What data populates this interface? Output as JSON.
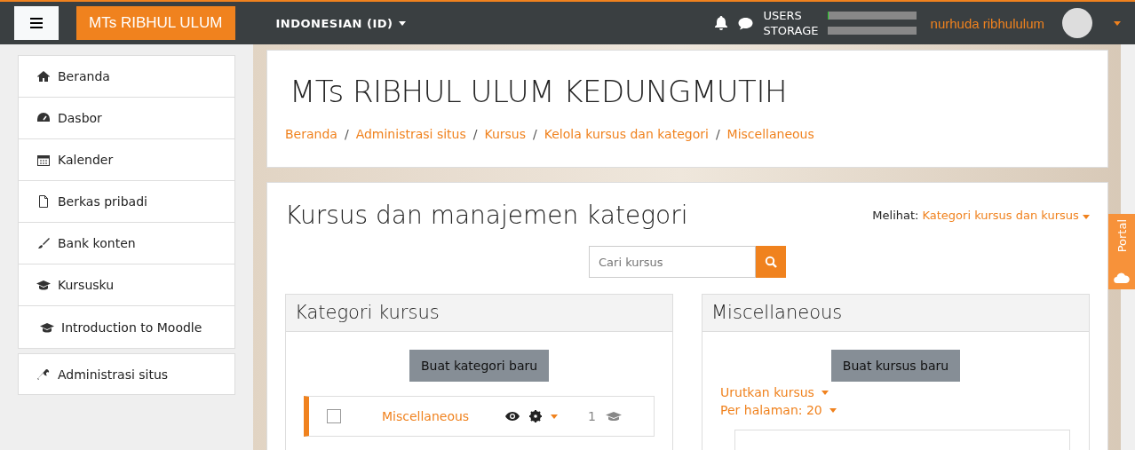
{
  "navbar": {
    "site_name": "MTs RIBHUL ULUM",
    "language": "INDONESIAN (ID)",
    "quota": [
      {
        "label": "USERS",
        "level": 0.01
      },
      {
        "label": "STORAGE"
      }
    ],
    "user_name": "nurhuda ribhululum"
  },
  "sidebar": {
    "items": [
      {
        "label": "Beranda",
        "kind": "home",
        "indent": false
      },
      {
        "label": "Dasbor",
        "kind": "dashboard",
        "indent": false
      },
      {
        "label": "Kalender",
        "kind": "calendar",
        "indent": false
      },
      {
        "label": "Berkas pribadi",
        "kind": "file",
        "indent": false
      },
      {
        "label": "Bank konten",
        "kind": "brush",
        "indent": false
      },
      {
        "label": "Kursusku",
        "kind": "cap",
        "indent": false
      },
      {
        "label": "Introduction to Moodle",
        "kind": "cap",
        "indent": true
      }
    ],
    "admin_item": {
      "label": "Administrasi situs",
      "kind": "wrench"
    }
  },
  "header": {
    "title": "MTs RIBHUL ULUM KEDUNGMUTIH",
    "breadcrumbs": [
      {
        "label": "Beranda"
      },
      {
        "separator": "/",
        "label": "Administrasi situs"
      },
      {
        "separator": "/",
        "label": "Kursus"
      },
      {
        "separator": "/",
        "label": "Kelola kursus dan kategori"
      },
      {
        "separator": "/",
        "label": "Miscellaneous"
      }
    ]
  },
  "main": {
    "title": "Kursus dan manajemen kategori",
    "view_label": "Melihat:",
    "view_value": "Kategori kursus dan kursus",
    "search_placeholder": "Cari kursus",
    "categories_panel": {
      "title": "Kategori kursus",
      "button": "Buat kategori baru",
      "rows": [
        {
          "name": "Miscellaneous",
          "count": "1",
          "selected": true,
          "checked": false
        }
      ]
    },
    "courses_panel": {
      "title": "Miscellaneous",
      "button": "Buat kursus baru",
      "sort": "Urutkan kursus",
      "per_page": "Per halaman: 20"
    }
  },
  "portal_tab": "Portal"
}
